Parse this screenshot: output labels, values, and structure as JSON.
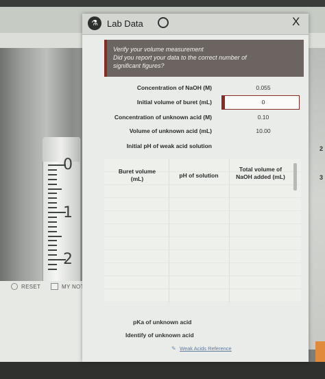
{
  "window": {
    "title": "Lab Data",
    "close_label": "X"
  },
  "notice": {
    "line1": "Verify your volume measurement",
    "line2": "Did you report your data to the correct number of",
    "line3": "significant figures?"
  },
  "data_rows": [
    {
      "label": "Concentration of NaOH (M)",
      "value": "0.055"
    },
    {
      "label": "Initial volume of buret (mL)",
      "value": "0"
    },
    {
      "label": "Concentration of unknown acid (M)",
      "value": "0.10"
    },
    {
      "label": "Volume of unknown acid (mL)",
      "value": "10.00"
    },
    {
      "label": "Initial pH of weak acid solution",
      "value": ""
    }
  ],
  "table": {
    "col1": [
      "Buret volume",
      "(mL)"
    ],
    "col2": [
      "pH of solution"
    ],
    "col3": [
      "Total volume of",
      "NaOH added (mL)"
    ]
  },
  "results": {
    "pka_label": "pKa of unknown acid",
    "identify_label": "Identify of unknown acid"
  },
  "link": {
    "weak_acids": "Weak Acids Reference"
  },
  "buttons": {
    "reset": "RESET",
    "notes": "MY NOTES"
  },
  "buret": {
    "marks": [
      "0",
      "1",
      "2"
    ]
  },
  "side_numbers": [
    "2",
    "3"
  ],
  "colors": {
    "accent": "#8b2a25",
    "notice_bg": "#6b6460"
  }
}
